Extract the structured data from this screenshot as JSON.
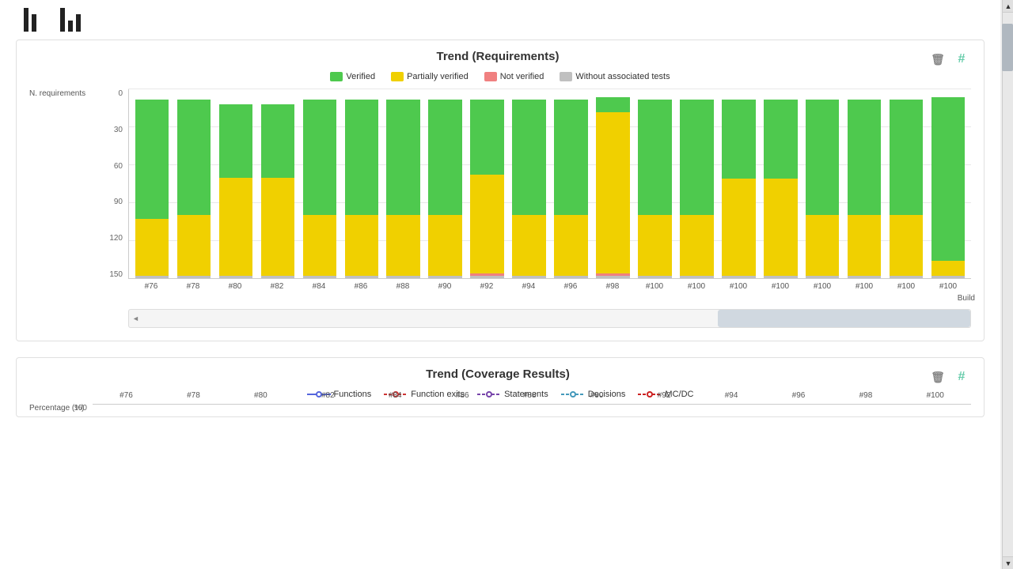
{
  "charts": {
    "requirements": {
      "title": "Trend (Requirements)",
      "y_axis_label": "N. requirements",
      "build_label": "Build",
      "legend": [
        {
          "label": "Verified",
          "color": "#4ec94e"
        },
        {
          "label": "Partially verified",
          "color": "#f0d000"
        },
        {
          "label": "Not verified",
          "color": "#f08080"
        },
        {
          "label": "Without associated tests",
          "color": "#c0c0c0"
        }
      ],
      "y_ticks": [
        "0",
        "30",
        "60",
        "90",
        "120",
        "150"
      ],
      "x_labels": [
        "#76",
        "#78",
        "#80",
        "#82",
        "#84",
        "#86",
        "#88",
        "#90",
        "#92",
        "#94",
        "#96",
        "#98",
        "#100"
      ],
      "bars": [
        {
          "verified": 95,
          "partial": 45,
          "not": 0,
          "without": 2
        },
        {
          "verified": 92,
          "partial": 48,
          "not": 0,
          "without": 2
        },
        {
          "verified": 58,
          "partial": 78,
          "not": 0,
          "without": 2
        },
        {
          "verified": 58,
          "partial": 78,
          "not": 0,
          "without": 2
        },
        {
          "verified": 92,
          "partial": 48,
          "not": 0,
          "without": 2
        },
        {
          "verified": 92,
          "partial": 48,
          "not": 0,
          "without": 2
        },
        {
          "verified": 92,
          "partial": 48,
          "not": 0,
          "without": 2
        },
        {
          "verified": 92,
          "partial": 48,
          "not": 0,
          "without": 2
        },
        {
          "verified": 60,
          "partial": 78,
          "not": 2,
          "without": 2
        },
        {
          "verified": 92,
          "partial": 48,
          "not": 0,
          "without": 2
        },
        {
          "verified": 92,
          "partial": 48,
          "not": 0,
          "without": 2
        },
        {
          "verified": 12,
          "partial": 128,
          "not": 2,
          "without": 2
        },
        {
          "verified": 92,
          "partial": 48,
          "not": 0,
          "without": 2
        },
        {
          "verified": 92,
          "partial": 48,
          "not": 0,
          "without": 2
        },
        {
          "verified": 63,
          "partial": 77,
          "not": 0,
          "without": 2
        },
        {
          "verified": 63,
          "partial": 77,
          "not": 0,
          "without": 2
        },
        {
          "verified": 92,
          "partial": 48,
          "not": 0,
          "without": 2
        },
        {
          "verified": 92,
          "partial": 48,
          "not": 0,
          "without": 2
        },
        {
          "verified": 92,
          "partial": 48,
          "not": 0,
          "without": 2
        },
        {
          "verified": 130,
          "partial": 12,
          "not": 0,
          "without": 2
        }
      ],
      "max_value": 150
    },
    "coverage": {
      "title": "Trend (Coverage Results)",
      "y_axis_label": "Percentage (%)",
      "y_ticks": [
        "100"
      ],
      "legend": [
        {
          "label": "Functions",
          "color": "#5566dd"
        },
        {
          "label": "Function exits",
          "color": "#cc3333"
        },
        {
          "label": "Statements",
          "color": "#7744aa"
        },
        {
          "label": "Decisions",
          "color": "#4499bb"
        },
        {
          "label": "MC/DC",
          "color": "#cc2222"
        }
      ]
    }
  },
  "icons": {
    "trash": "🗑",
    "hash": "#",
    "scroll_up": "▲",
    "scroll_down": "▼",
    "scroll_left": "◄",
    "scroll_right": "►"
  },
  "top_icons": {
    "icon1": "bar-chart-1",
    "icon2": "bar-chart-2"
  }
}
